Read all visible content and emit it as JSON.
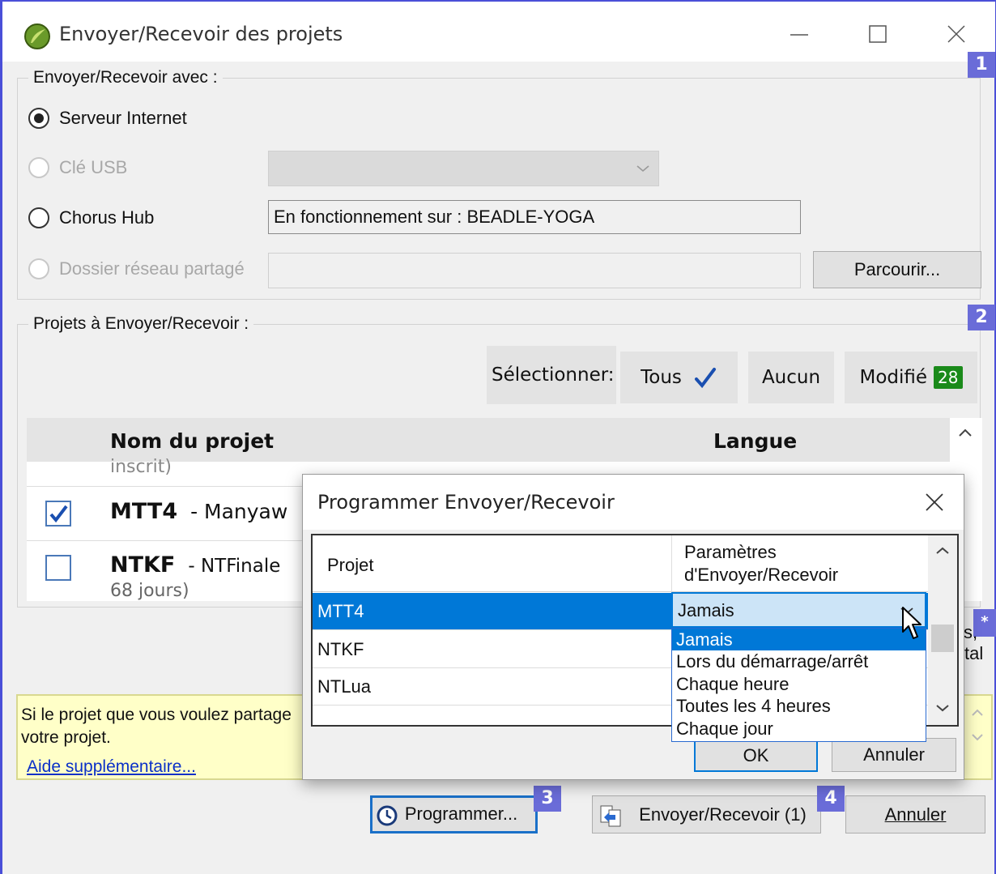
{
  "window": {
    "title": "Envoyer/Recevoir des projets"
  },
  "group1": {
    "legend": "Envoyer/Recevoir avec :",
    "badge": "1",
    "options": [
      {
        "label": "Serveur Internet",
        "selected": true,
        "enabled": true
      },
      {
        "label": "Clé USB",
        "selected": false,
        "enabled": false
      },
      {
        "label": "Chorus Hub",
        "selected": false,
        "enabled": true
      },
      {
        "label": "Dossier réseau partagé",
        "selected": false,
        "enabled": false
      }
    ],
    "chorus_hub_value": "En fonctionnement sur : BEADLE-YOGA",
    "browse_label": "Parcourir..."
  },
  "group2": {
    "legend": "Projets à Envoyer/Recevoir :",
    "badge": "2",
    "select_label": "Sélectionner:",
    "all_label": "Tous",
    "none_label": "Aucun",
    "modified_label": "Modifié",
    "modified_count": "28",
    "col_name": "Nom du projet",
    "col_lang": "Langue",
    "partial_top": "inscrit)",
    "rows": [
      {
        "code": "MTT4",
        "name": "- Manyaw",
        "checked": true
      },
      {
        "code": "NTKF",
        "name": "- NTFinale",
        "sub": "68 jours)",
        "checked": false
      }
    ],
    "side_badge": "*",
    "side_text_1": "s,",
    "side_text_2": "tal"
  },
  "info": {
    "line1": "Si le projet que vous voulez partage",
    "line2": "votre projet.",
    "link": "Aide supplémentaire..."
  },
  "footer": {
    "schedule_label": "Programmer...",
    "schedule_badge": "3",
    "sendreceive_label": "Envoyer/Recevoir (1)",
    "sendreceive_badge": "4",
    "cancel_label": "Annuler"
  },
  "dialog": {
    "title": "Programmer Envoyer/Recevoir",
    "col_project": "Projet",
    "col_params_1": "Paramètres",
    "col_params_2": "d'Envoyer/Recevoir",
    "rows": [
      "MTT4",
      "NTKF",
      "NTLua"
    ],
    "combo_value": "Jamais",
    "options": [
      "Jamais",
      "Lors du démarrage/arrêt",
      "Chaque heure",
      "Toutes les 4 heures",
      "Chaque jour"
    ],
    "selected_option": 0,
    "ok_label": "OK",
    "cancel_label": "Annuler"
  },
  "colors": {
    "accent": "#0078d7",
    "badge": "#6a6cd8",
    "count": "#1a8a1a",
    "info_bg": "#ffffc8"
  }
}
